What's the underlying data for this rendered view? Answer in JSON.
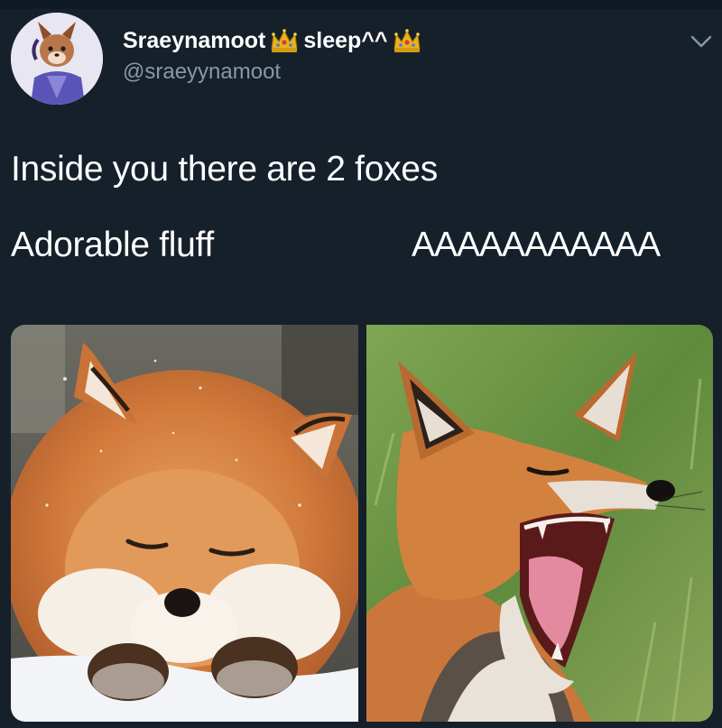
{
  "tweet": {
    "author": {
      "display_name_part1": "Sraeynamoot",
      "display_name_part2": "sleep^^",
      "handle": "@sraeyynamoot",
      "badge_icon": "crown-icon"
    },
    "text": "Inside you there are 2 foxes",
    "labels": {
      "left": "Adorable fluff",
      "right": "AAAAAAAAAAA"
    },
    "media": [
      {
        "subject": "sleepy-fox-photo"
      },
      {
        "subject": "yawning-fox-photo"
      }
    ]
  },
  "colors": {
    "background": "#15202b",
    "secondary_text": "#8899a6",
    "primary_text": "#ffffff"
  }
}
